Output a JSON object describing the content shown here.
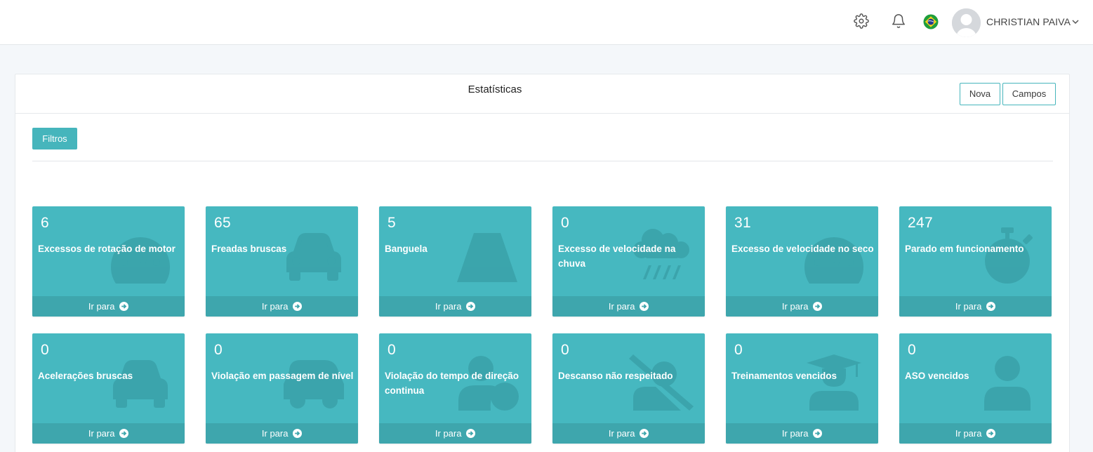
{
  "header": {
    "user_name": "CHRISTIAN PAIVA",
    "icons": [
      "settings-icon",
      "bell-icon",
      "brazil-flag-icon",
      "avatar",
      "chevron-down-icon"
    ]
  },
  "panel": {
    "title": "Estatísticas",
    "buttons": {
      "nova": "Nova",
      "campos": "Campos"
    },
    "filters_button": "Filtros"
  },
  "cards": [
    {
      "value": "6",
      "label": "Excessos de rotação de motor",
      "link": "Ir para",
      "icon": "speedometer-icon"
    },
    {
      "value": "65",
      "label": "Freadas bruscas",
      "link": "Ir para",
      "icon": "car-icon"
    },
    {
      "value": "5",
      "label": "Banguela",
      "link": "Ir para",
      "icon": "road-icon"
    },
    {
      "value": "0",
      "label": "Excesso de velocidade na chuva",
      "link": "Ir para",
      "icon": "rain-cloud-icon"
    },
    {
      "value": "31",
      "label": "Excesso de velocidade no seco",
      "link": "Ir para",
      "icon": "speedometer-icon"
    },
    {
      "value": "247",
      "label": "Parado em funcionamento",
      "link": "Ir para",
      "icon": "stopwatch-icon"
    },
    {
      "value": "0",
      "label": "Acelerações bruscas",
      "link": "Ir para",
      "icon": "car-icon"
    },
    {
      "value": "0",
      "label": "Violação em passagem de nível",
      "link": "Ir para",
      "icon": "bus-icon"
    },
    {
      "value": "0",
      "label": "Violação do tempo de direção continua",
      "link": "Ir para",
      "icon": "user-clock-icon"
    },
    {
      "value": "0",
      "label": "Descanso não respeitado",
      "link": "Ir para",
      "icon": "bed-slash-icon"
    },
    {
      "value": "0",
      "label": "Treinamentos vencidos",
      "link": "Ir para",
      "icon": "graduate-icon"
    },
    {
      "value": "0",
      "label": "ASO vencidos",
      "link": "Ir para",
      "icon": "doctor-icon"
    }
  ],
  "colors": {
    "accent": "#46b8c0",
    "card_footer": "#3ea6ad",
    "page_bg": "#f4f7fa"
  }
}
